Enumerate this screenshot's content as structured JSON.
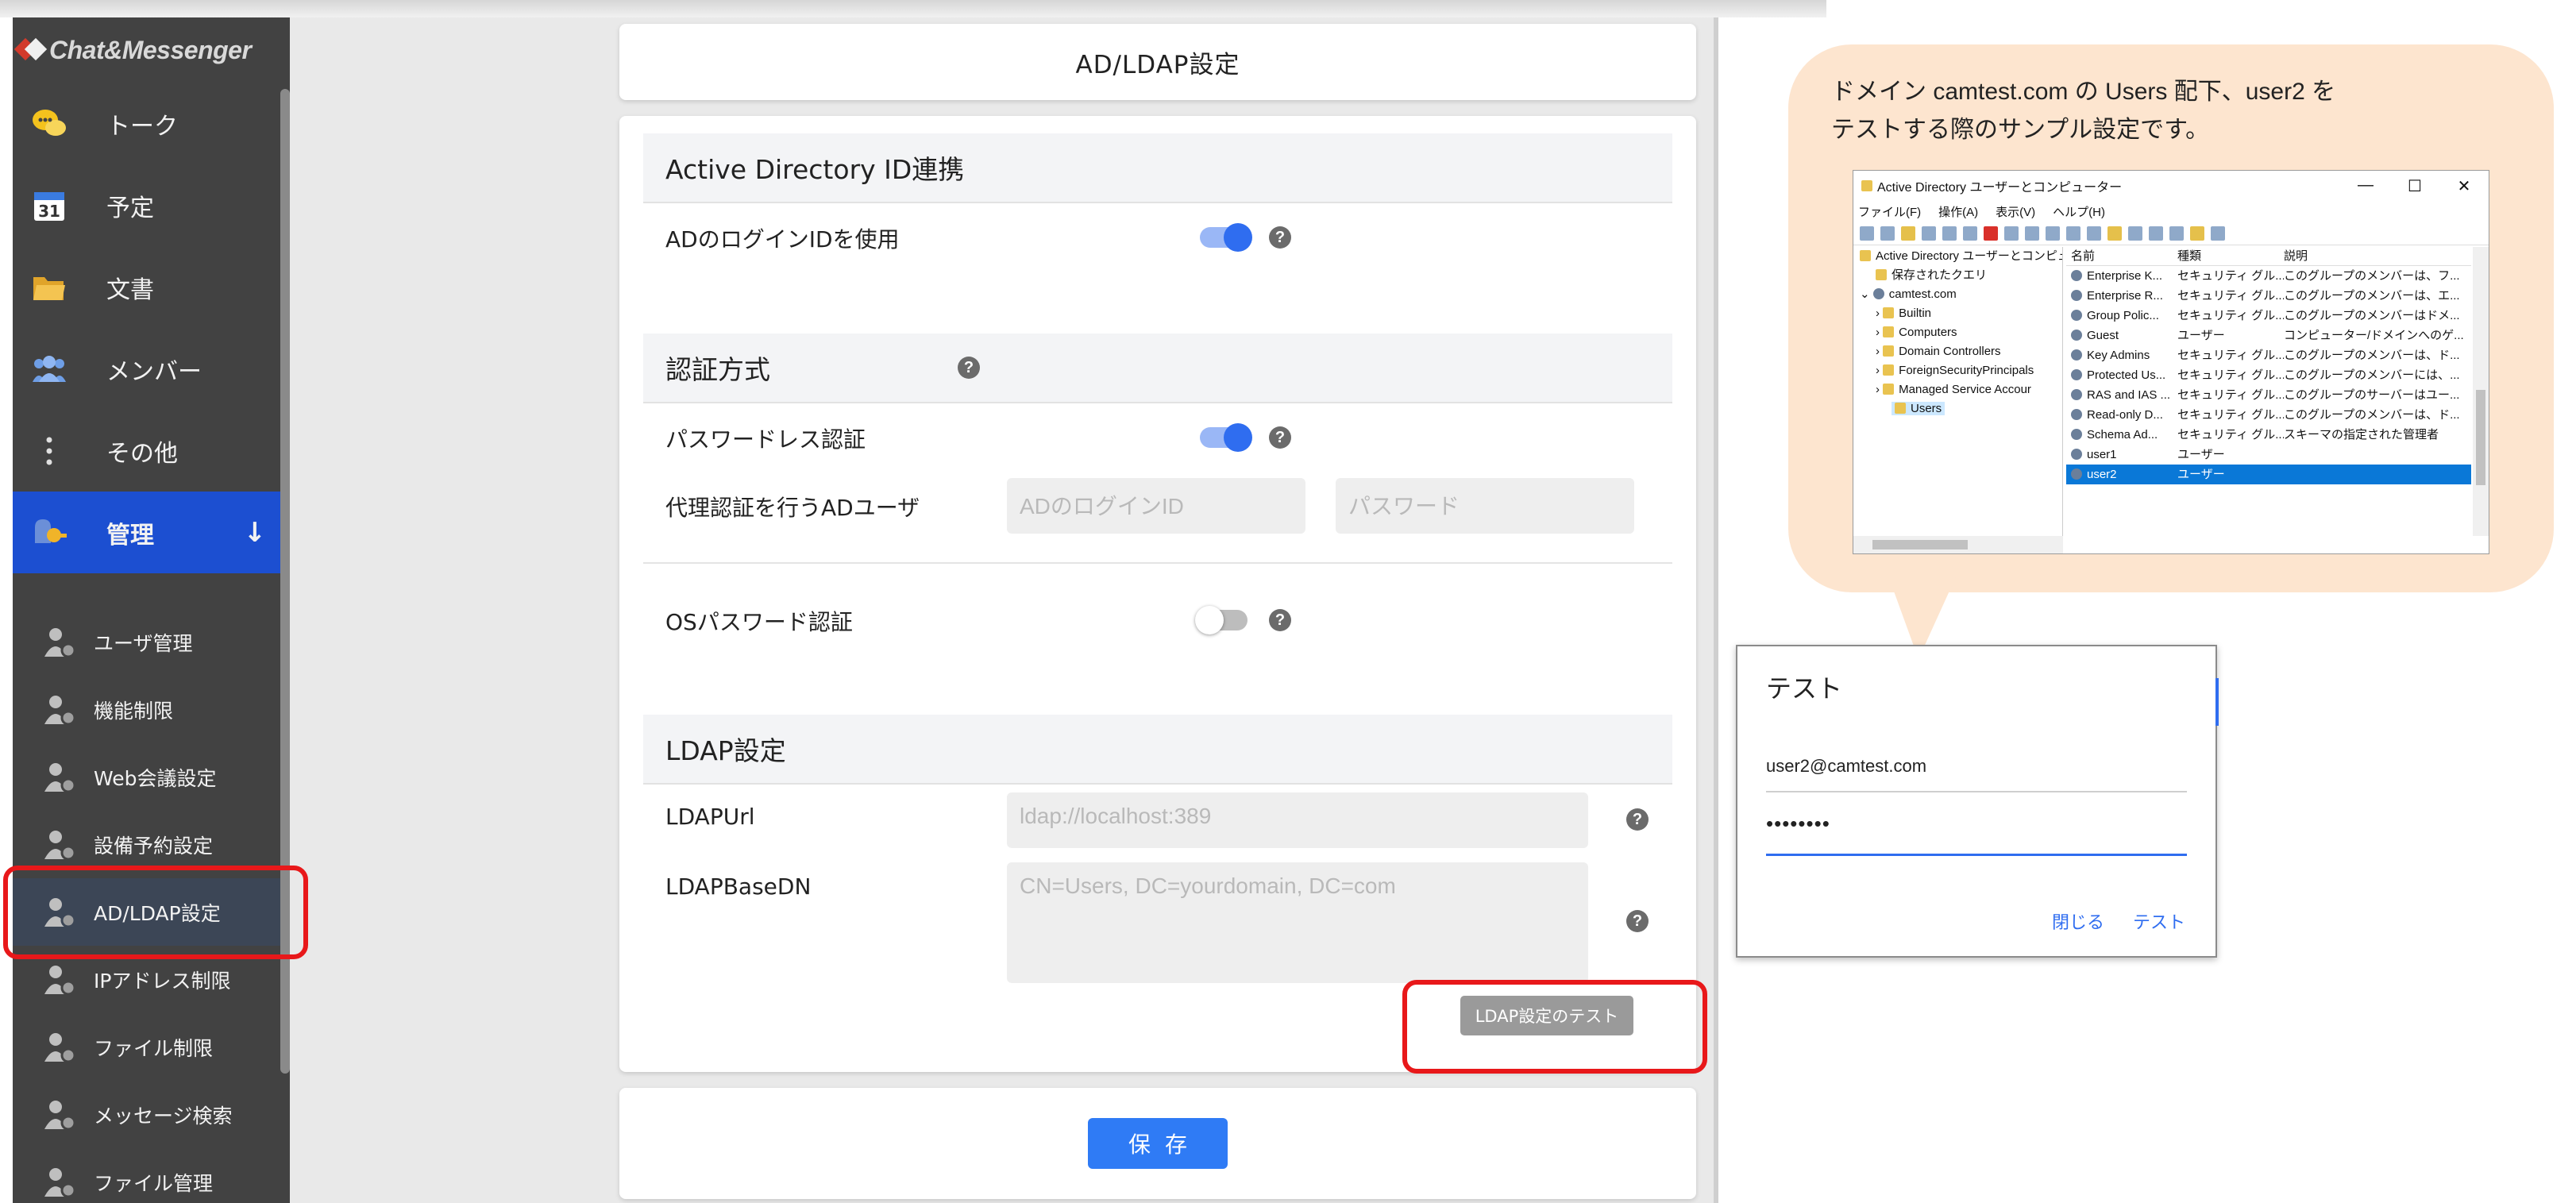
{
  "brand": {
    "name": "Chat&Messenger"
  },
  "sidebar": {
    "nav": [
      {
        "label": "トーク",
        "icon": "chat-bubbles-icon"
      },
      {
        "label": "予定",
        "icon": "calendar-icon"
      },
      {
        "label": "文書",
        "icon": "folder-icon"
      },
      {
        "label": "メンバー",
        "icon": "members-icon"
      },
      {
        "label": "その他",
        "icon": "more-vertical-icon"
      },
      {
        "label": "管理",
        "icon": "admin-key-icon",
        "arrow": "↓"
      }
    ],
    "calendar_day": "31",
    "sub": [
      "ユーザ管理",
      "機能制限",
      "Web会議設定",
      "設備予約設定",
      "AD/LDAP設定",
      "IPアドレス制限",
      "ファイル制限",
      "メッセージ検索",
      "ファイル管理"
    ]
  },
  "page": {
    "title": "AD/LDAP設定"
  },
  "ad": {
    "heading": "Active Directory ID連携",
    "use_login_id": {
      "label": "ADのログインIDを使用",
      "on": true
    }
  },
  "auth": {
    "heading": "認証方式",
    "passwordless": {
      "label": "パスワードレス認証",
      "on": true
    },
    "proxy": {
      "label": "代理認証を行うADユーザ",
      "id_placeholder": "ADのログインID",
      "pw_placeholder": "パスワード"
    },
    "os_password": {
      "label": "OSパスワード認証",
      "on": false
    }
  },
  "ldap": {
    "heading": "LDAP設定",
    "url_label": "LDAPUrl",
    "url_placeholder": "ldap://localhost:389",
    "basedn_label": "LDAPBaseDN",
    "basedn_placeholder": "CN=Users, DC=yourdomain, DC=com",
    "test_button": "LDAP設定のテスト"
  },
  "save_button": "保存",
  "help_glyph": "?",
  "callout": {
    "line1": "ドメイン camtest.com の Users 配下、user2 を",
    "line2": "テストする際のサンプル設定です。"
  },
  "ad_window": {
    "title": "Active Directory ユーザーとコンピューター",
    "controls": [
      "—",
      "☐",
      "✕"
    ],
    "menu": [
      "ファイル(F)",
      "操作(A)",
      "表示(V)",
      "ヘルプ(H)"
    ],
    "tree": [
      "Active Directory ユーザーとコンピュ",
      "保存されたクエリ",
      "camtest.com",
      "Builtin",
      "Computers",
      "Domain Controllers",
      "ForeignSecurityPrincipals",
      "Managed Service Accour",
      "Users"
    ],
    "columns": [
      "名前",
      "種類",
      "説明"
    ],
    "rows": [
      [
        "Enterprise K...",
        "セキュリティ グル...",
        "このグループのメンバーは、フ..."
      ],
      [
        "Enterprise R...",
        "セキュリティ グル...",
        "このグループのメンバーは、エ..."
      ],
      [
        "Group Polic...",
        "セキュリティ グル...",
        "このグループのメンバーはドメ..."
      ],
      [
        "Guest",
        "ユーザー",
        "コンピューター/ドメインへのゲ..."
      ],
      [
        "Key Admins",
        "セキュリティ グル...",
        "このグループのメンバーは、ド..."
      ],
      [
        "Protected Us...",
        "セキュリティ グル...",
        "このグループのメンバーには、..."
      ],
      [
        "RAS and IAS ...",
        "セキュリティ グル...",
        "このグループのサーバーはユー..."
      ],
      [
        "Read-only D...",
        "セキュリティ グル...",
        "このグループのメンバーは、ド..."
      ],
      [
        "Schema Ad...",
        "セキュリティ グル...",
        "スキーマの指定された管理者"
      ],
      [
        "user1",
        "ユーザー",
        ""
      ],
      [
        "user2",
        "ユーザー",
        ""
      ]
    ]
  },
  "test_dialog": {
    "title": "テスト",
    "email_value": "user2@camtest.com",
    "password_value": "••••••••",
    "close_button": "閉じる",
    "test_button": "テスト"
  },
  "colors": {
    "accent": "#2f6df0",
    "active_nav": "#1c4fd1",
    "highlight": "#e8181a",
    "callout": "#fde5cf"
  }
}
